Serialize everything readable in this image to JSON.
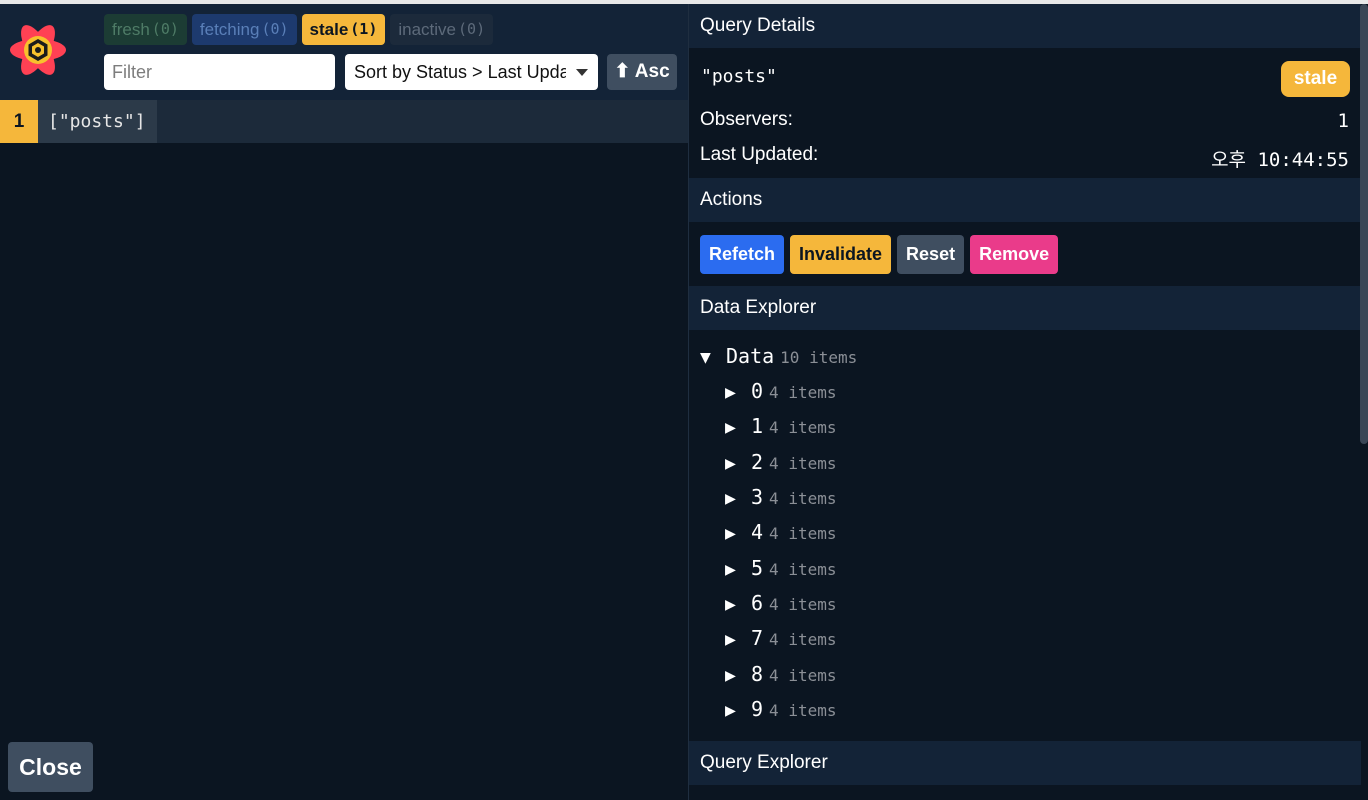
{
  "filters": [
    {
      "label": "fresh",
      "count": "(0)"
    },
    {
      "label": "fetching",
      "count": "(0)"
    },
    {
      "label": "stale",
      "count": "(1)"
    },
    {
      "label": "inactive",
      "count": "(0)"
    }
  ],
  "filter_input": {
    "placeholder": "Filter",
    "value": ""
  },
  "sort": {
    "label": "Sort by Status > Last Updated"
  },
  "sort_direction": {
    "label": "⬆ Asc"
  },
  "query_list": [
    {
      "observers": "1",
      "key": "[\"posts\"]"
    }
  ],
  "close_label": "Close",
  "details": {
    "title": "Query Details",
    "key": "\"posts\"",
    "status": "stale",
    "observers_label": "Observers:",
    "observers_value": "1",
    "last_updated_label": "Last Updated:",
    "last_updated_value": "오후 10:44:55"
  },
  "actions": {
    "title": "Actions",
    "refetch": "Refetch",
    "invalidate": "Invalidate",
    "reset": "Reset",
    "remove": "Remove"
  },
  "data_explorer": {
    "title": "Data Explorer",
    "root_label": "Data",
    "root_count": "10 items",
    "items": [
      {
        "key": "0",
        "count": "4 items"
      },
      {
        "key": "1",
        "count": "4 items"
      },
      {
        "key": "2",
        "count": "4 items"
      },
      {
        "key": "3",
        "count": "4 items"
      },
      {
        "key": "4",
        "count": "4 items"
      },
      {
        "key": "5",
        "count": "4 items"
      },
      {
        "key": "6",
        "count": "4 items"
      },
      {
        "key": "7",
        "count": "4 items"
      },
      {
        "key": "8",
        "count": "4 items"
      },
      {
        "key": "9",
        "count": "4 items"
      }
    ]
  },
  "query_explorer": {
    "title": "Query Explorer"
  },
  "icons": {
    "logo": "react-query-logo-icon",
    "expanded": "triangle-down-icon",
    "collapsed": "triangle-right-icon"
  },
  "colors": {
    "fresh": "#1c3c34",
    "fetching": "#1d3a6e",
    "stale": "#f5b73b",
    "inactive": "#1c2a3b",
    "refetch": "#2b6cf0",
    "remove": "#ea3b8a"
  }
}
